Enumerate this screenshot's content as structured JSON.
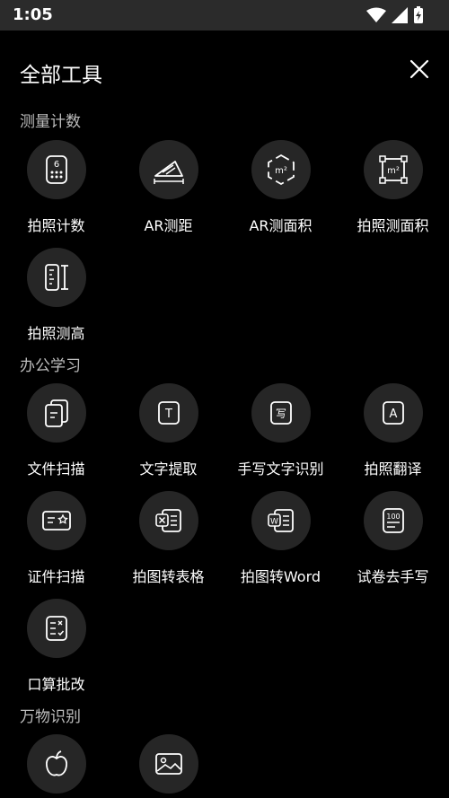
{
  "status": {
    "time": "1:05"
  },
  "header": {
    "title": "全部工具"
  },
  "sections": {
    "measure": {
      "title": "测量计数",
      "items": [
        {
          "label": "拍照计数"
        },
        {
          "label": "AR测距"
        },
        {
          "label": "AR测面积"
        },
        {
          "label": "拍照测面积"
        },
        {
          "label": "拍照测高"
        }
      ]
    },
    "office": {
      "title": "办公学习",
      "items": [
        {
          "label": "文件扫描"
        },
        {
          "label": "文字提取"
        },
        {
          "label": "手写文字识别"
        },
        {
          "label": "拍照翻译"
        },
        {
          "label": "证件扫描"
        },
        {
          "label": "拍图转表格"
        },
        {
          "label": "拍图转Word"
        },
        {
          "label": "试卷去手写"
        },
        {
          "label": "口算批改"
        }
      ]
    },
    "objects": {
      "title": "万物识别",
      "items": [
        {
          "label": ""
        },
        {
          "label": ""
        }
      ]
    }
  },
  "icon_text": {
    "count": "6",
    "m2": "m²",
    "textT": "T",
    "write": "写",
    "letterA": "A",
    "word": "W",
    "score": "100"
  }
}
